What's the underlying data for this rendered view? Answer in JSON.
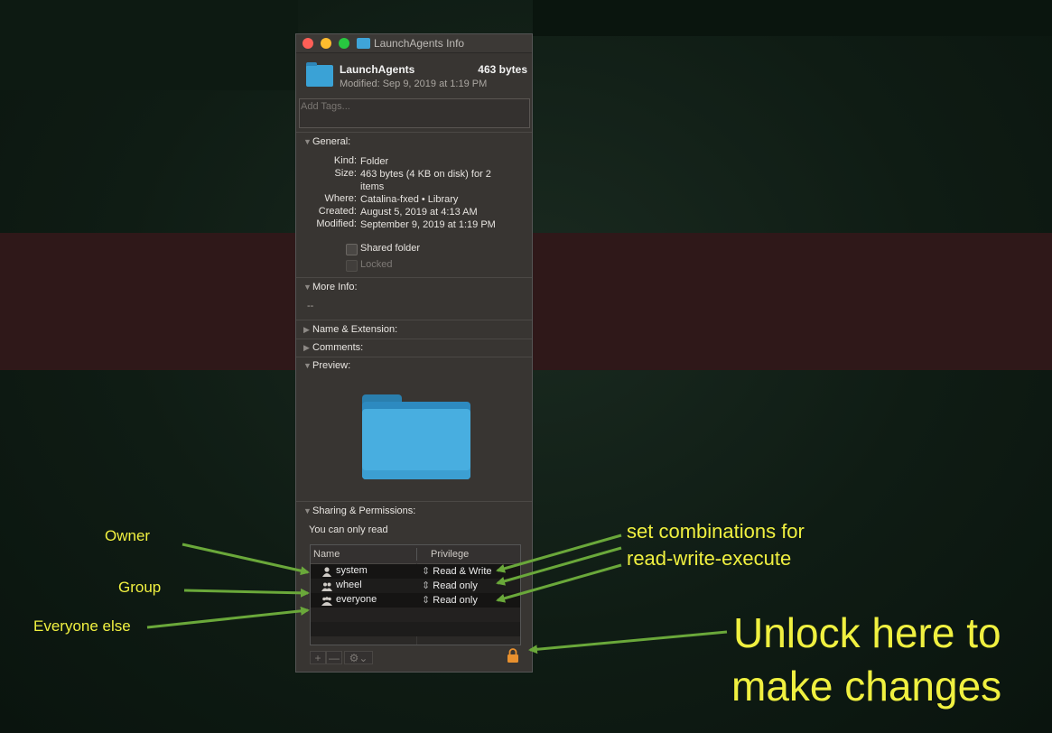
{
  "window": {
    "title": "LaunchAgents Info",
    "name": "LaunchAgents",
    "size": "463 bytes",
    "modified": "Modified: Sep 9, 2019 at 1:19 PM",
    "tags_placeholder": "Add Tags..."
  },
  "general": {
    "header": "General:",
    "rows": [
      {
        "label": "Kind:",
        "value": "Folder"
      },
      {
        "label": "Size:",
        "value": "463 bytes (4 KB on disk) for 2 items"
      },
      {
        "label": "Where:",
        "value": "Catalina-fxed • Library"
      },
      {
        "label": "Created:",
        "value": "August 5, 2019 at 4:13 AM"
      },
      {
        "label": "Modified:",
        "value": "September 9, 2019 at 1:19 PM"
      }
    ],
    "shared_folder": "Shared folder",
    "locked": "Locked"
  },
  "more_info": {
    "header": "More Info:",
    "value": "--"
  },
  "name_ext": {
    "header": "Name & Extension:"
  },
  "comments": {
    "header": "Comments:"
  },
  "preview": {
    "header": "Preview:"
  },
  "permissions": {
    "header": "Sharing & Permissions:",
    "subtitle": "You can only read",
    "col_name": "Name",
    "col_priv": "Privilege",
    "rows": [
      {
        "name": "system",
        "privilege": "Read & Write"
      },
      {
        "name": "wheel",
        "privilege": "Read only"
      },
      {
        "name": "everyone",
        "privilege": "Read only"
      }
    ],
    "add": "+",
    "remove": "—",
    "action": "⚙⌄"
  },
  "annotations": {
    "owner": "Owner",
    "group": "Group",
    "everyone": "Everyone else",
    "combos_1": "set combinations for",
    "combos_2": "read-write-execute",
    "unlock_1": "Unlock here to",
    "unlock_2": "make changes",
    "color": "#f0f040",
    "arrow_color": "#6aa83a"
  }
}
